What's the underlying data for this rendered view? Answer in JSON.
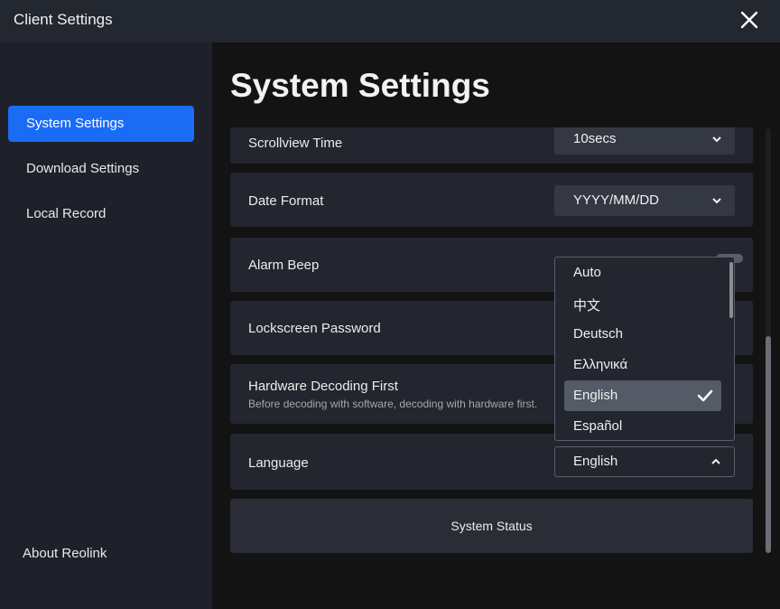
{
  "window": {
    "title": "Client Settings",
    "close_icon": "close-icon"
  },
  "sidebar": {
    "items": [
      {
        "label": "System Settings",
        "active": true
      },
      {
        "label": "Download Settings",
        "active": false
      },
      {
        "label": "Local Record",
        "active": false
      }
    ],
    "about": "About Reolink"
  },
  "main": {
    "title": "System Settings",
    "rows": {
      "scrollview": {
        "label": "Scrollview Time",
        "value": "10secs"
      },
      "date_format": {
        "label": "Date Format",
        "value": "YYYY/MM/DD"
      },
      "alarm_beep": {
        "label": "Alarm Beep"
      },
      "lockscreen": {
        "label": "Lockscreen Password"
      },
      "hw_decoding": {
        "label": "Hardware Decoding First",
        "description": "Before decoding with software, decoding with hardware first."
      },
      "language": {
        "label": "Language",
        "value": "English"
      }
    },
    "status_button": "System Status",
    "language_options": [
      "Auto",
      "中文",
      "Deutsch",
      "Ελληνικά",
      "English",
      "Español"
    ],
    "selected_language": "English"
  },
  "colors": {
    "accent": "#1a6cf5",
    "panel": "#23262e",
    "sidebar": "#1e2129"
  }
}
